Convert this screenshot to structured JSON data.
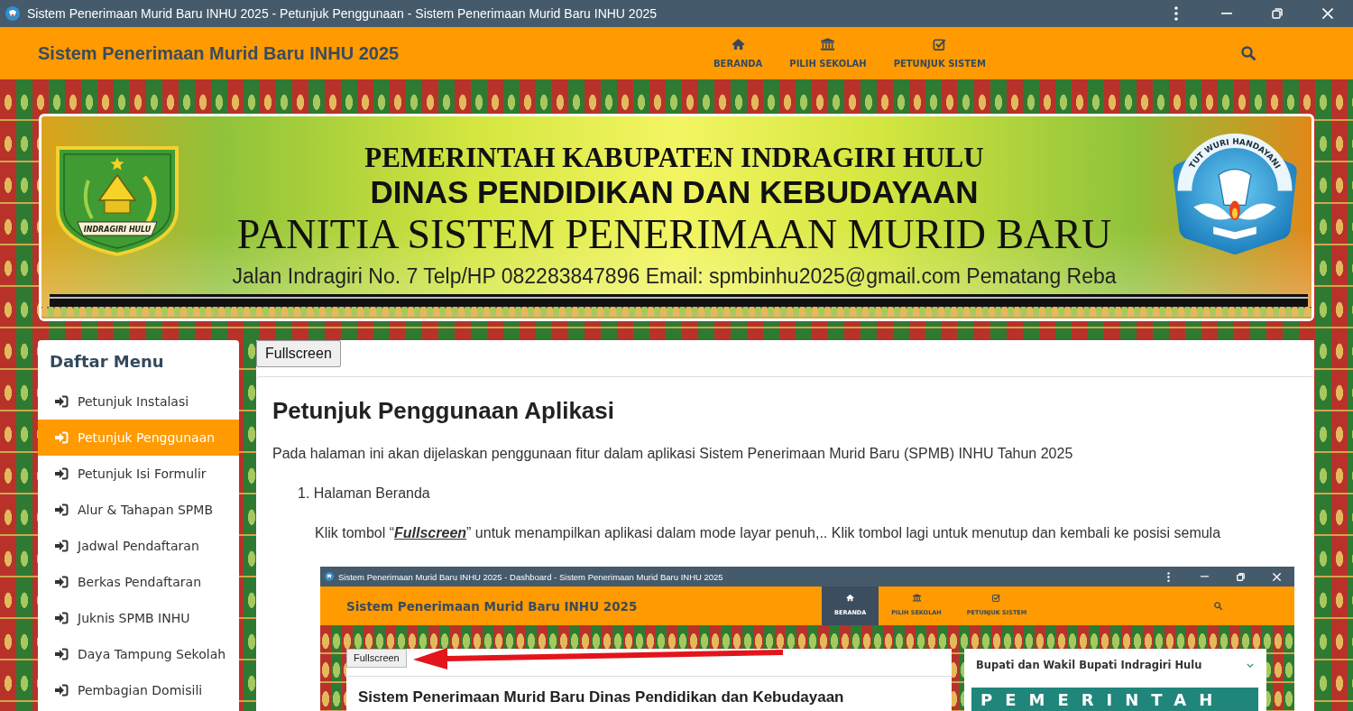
{
  "window": {
    "title": "Sistem Penerimaan Murid Baru INHU 2025 - Petunjuk Penggunaan - Sistem Penerimaan Murid Baru INHU 2025"
  },
  "navbar": {
    "brand": "Sistem Penerimaan Murid Baru INHU 2025",
    "items": [
      {
        "label": "BERANDA",
        "selected": false
      },
      {
        "label": "PILIH SEKOLAH",
        "selected": false
      },
      {
        "label": "PETUNJUK SISTEM",
        "selected": false
      }
    ]
  },
  "banner": {
    "emblem_caption": "INDRAGIRI HULU",
    "agency": "PEMERINTAH KABUPATEN INDRAGIRI HULU",
    "department": "DINAS PENDIDIKAN DAN KEBUDAYAAN",
    "committee": "PANITIA SISTEM PENERIMAAN MURID BARU",
    "address": "Jalan Indragiri No. 7 Telp/HP 082283847896 Email: spmbinhu2025@gmail.com Pematang Reba",
    "logo_motto": "TUT WURI HANDAYANI"
  },
  "sidebar": {
    "title": "Daftar Menu",
    "items": [
      {
        "label": "Petunjuk Instalasi",
        "selected": false
      },
      {
        "label": "Petunjuk Penggunaan",
        "selected": true
      },
      {
        "label": "Petunjuk Isi Formulir",
        "selected": false
      },
      {
        "label": "Alur & Tahapan SPMB",
        "selected": false
      },
      {
        "label": "Jadwal Pendaftaran",
        "selected": false
      },
      {
        "label": "Berkas Pendaftaran",
        "selected": false
      },
      {
        "label": "Juknis SPMB INHU",
        "selected": false
      },
      {
        "label": "Daya Tampung Sekolah",
        "selected": false
      },
      {
        "label": "Pembagian Domisili",
        "selected": false
      }
    ]
  },
  "content": {
    "fullscreen_button": "Fullscreen",
    "heading": "Petunjuk Penggunaan Aplikasi",
    "intro": "Pada halaman ini akan dijelaskan penggunaan fitur dalam aplikasi Sistem Penerimaan Murid Baru (SPMB) INHU Tahun 2025",
    "steps": [
      {
        "number": "1.",
        "title": "Halaman Beranda",
        "instruction": {
          "before": "Klik tombol “",
          "emphasis": "Fullscreen",
          "after": "” untuk menampilkan aplikasi dalam mode layar penuh,.. Klik tombol lagi untuk menutup dan kembali ke posisi semula"
        },
        "screenshot": {
          "window_title": "Sistem Penerimaan Murid Baru INHU 2025 - Dashboard - Sistem Penerimaan Murid Baru INHU 2025",
          "brand": "Sistem Penerimaan Murid Baru INHU 2025",
          "nav": [
            {
              "label": "BERANDA",
              "selected": true
            },
            {
              "label": "PILIH SEKOLAH",
              "selected": false
            },
            {
              "label": "PETUNJUK SISTEM",
              "selected": false
            }
          ],
          "fullscreen_button": "Fullscreen",
          "heading": "Sistem Penerimaan Murid Baru Dinas Pendidikan dan Kebudayaan",
          "side_card": {
            "title": "Bupati dan Wakil Bupati Indragiri Hulu",
            "banner_text": "PEMERINTAH"
          }
        }
      }
    ]
  }
}
